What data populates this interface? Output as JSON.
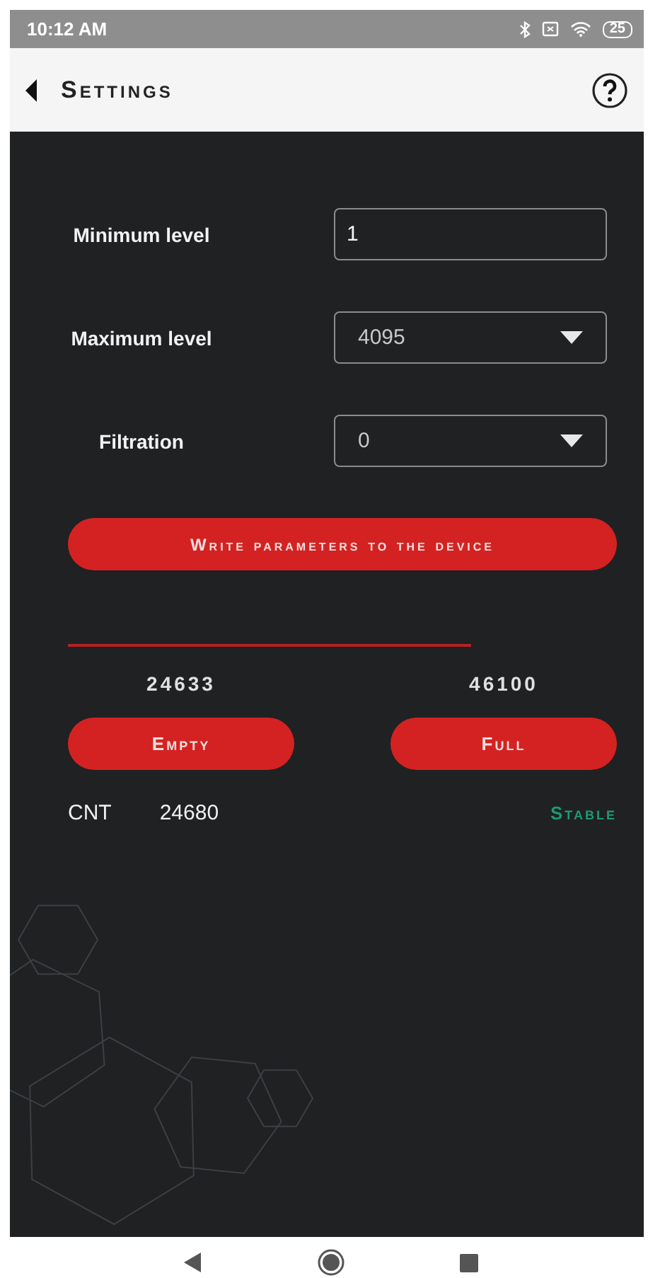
{
  "status_bar": {
    "time": "10:12 AM",
    "battery": "25"
  },
  "header": {
    "title": "Settings"
  },
  "fields": [
    {
      "kind": "input",
      "label": "Minimum level",
      "value": "1"
    },
    {
      "kind": "dropdown",
      "label": "Maximum level",
      "value": "4095"
    },
    {
      "kind": "dropdown",
      "label": "Filtration",
      "value": "0"
    }
  ],
  "write_button": "Write parameters to the device",
  "calibration": {
    "points": [
      {
        "value": "24633",
        "button": "Empty"
      },
      {
        "value": "46100",
        "button": "Full"
      }
    ]
  },
  "counter": {
    "label": "CNT",
    "value": "24680",
    "status": "Stable"
  }
}
